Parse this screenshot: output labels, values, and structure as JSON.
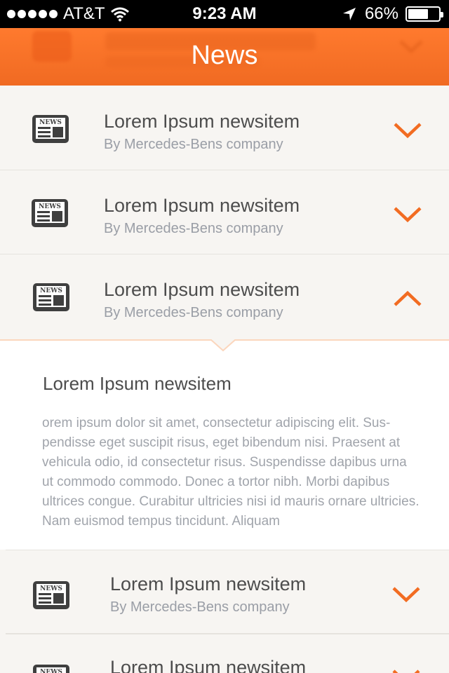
{
  "status_bar": {
    "carrier": "AT&T",
    "time": "9:23 AM",
    "battery": "66%",
    "battery_level": 0.66,
    "signal_icon": "signal-dots-icon",
    "wifi_icon": "wifi-icon",
    "location_icon": "location-arrow-icon"
  },
  "header": {
    "title": "News"
  },
  "news_icon_label": "NEWS",
  "items": [
    {
      "title": "Lorem Ipsum newsitem",
      "subtitle": "By Mercedes-Bens company",
      "state": "collapsed"
    },
    {
      "title": "Lorem Ipsum newsitem",
      "subtitle": "By Mercedes-Bens company",
      "state": "collapsed"
    },
    {
      "title": "Lorem Ipsum newsitem",
      "subtitle": "By Mercedes-Bens company",
      "state": "expanded"
    },
    {
      "title": "Lorem Ipsum newsitem",
      "subtitle": "By Mercedes-Bens company",
      "state": "collapsed"
    },
    {
      "title": "Lorem Ipsum newsitem",
      "subtitle": "",
      "state": "collapsed"
    }
  ],
  "expanded": {
    "title": "Lorem Ipsum newsitem",
    "body": "orem ipsum dolor sit amet, consectetur adipiscing elit. Sus- pendisse eget suscipit risus, eget bibendum nisi. Praesent at vehicula odio, id consectetur risus. Suspendisse dapibus urna ut commodo commodo. Donec a tortor nibh. Morbi dapibus ultrices congue. Curabitur ultricies nisi id mauris ornare ultricies. Nam euismod tempus tincidunt. Aliquam"
  },
  "colors": {
    "accent": "#f26c22",
    "header_bg": "#ff7a2e",
    "row_bg": "#f7f5f2",
    "title_text": "#4d4d4d",
    "sub_text": "#9a9ea6"
  }
}
